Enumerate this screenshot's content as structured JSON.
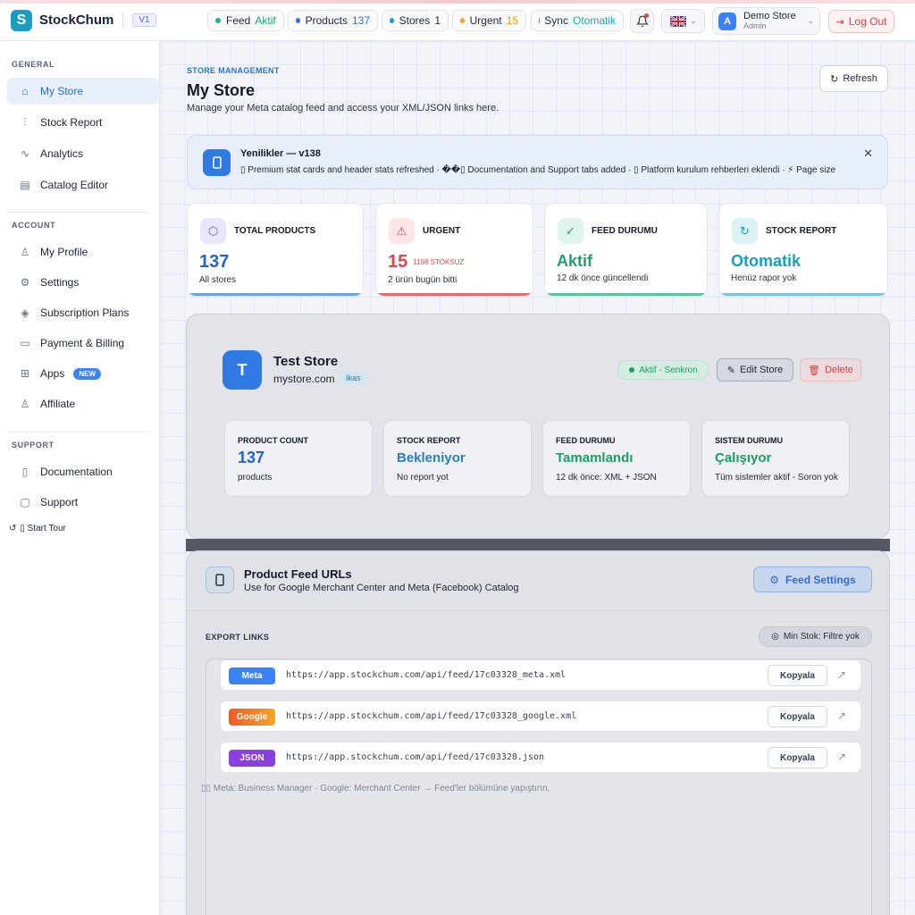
{
  "app": {
    "brand": "StockChum",
    "logo_letter": "S",
    "version": "V1"
  },
  "header": {
    "stats": [
      {
        "label": "Feed",
        "value": "Aktif",
        "dot_color": "#22b573",
        "value_color": "#22a06b"
      },
      {
        "label": "Products",
        "value": "137",
        "dot_color": "#3b6fe0",
        "value_color": "#2f6fd1"
      },
      {
        "label": "Stores",
        "value": "1",
        "dot_color": "#1aa3c9",
        "value_color": "#1f2533"
      },
      {
        "label": "Urgent",
        "value": "15",
        "dot_color": "#f2a51a",
        "value_color": "#e09a0d"
      },
      {
        "label": "Sync",
        "value": "Otomatik",
        "dot_color": "#14b4b0",
        "value_color": "#14a8b4"
      }
    ],
    "notifications_icon": "bell-icon",
    "language_icon": "uk-flag-icon",
    "user": {
      "avatar_letter": "A",
      "name": "Demo Store",
      "role": "Admin"
    },
    "logout_label": "Log Out"
  },
  "sidebar": {
    "general_title": "GENERAL",
    "general_items": [
      {
        "label": "My Store",
        "icon": "home-icon"
      },
      {
        "label": "Stock Report",
        "icon": "bar-chart-icon"
      },
      {
        "label": "Analytics",
        "icon": "activity-icon"
      },
      {
        "label": "Catalog Editor",
        "icon": "grid-icon"
      }
    ],
    "account_title": "ACCOUNT",
    "account_items": [
      {
        "label": "My Profile",
        "icon": "user-icon"
      },
      {
        "label": "Settings",
        "icon": "gear-icon"
      },
      {
        "label": "Subscription Plans",
        "icon": "layers-icon"
      },
      {
        "label": "Payment & Billing",
        "icon": "credit-card-icon"
      },
      {
        "label": "Apps",
        "icon": "apps-icon",
        "badge": "NEW"
      },
      {
        "label": "Affiliate",
        "icon": "user-plus-icon"
      }
    ],
    "support_title": "SUPPORT",
    "support_items": [
      {
        "label": "Documentation",
        "icon": "book-icon"
      },
      {
        "label": "Support",
        "icon": "chat-icon"
      }
    ],
    "start_tour": "▯ Start Tour"
  },
  "page": {
    "eyebrow": "STORE MANAGEMENT",
    "title": "My Store",
    "subtitle": "Manage your Meta catalog feed and access your XML/JSON links here.",
    "refresh_label": "Refresh"
  },
  "news": {
    "title": "Yenilikler — v138",
    "text": "▯ Premium stat cards and header stats refreshed · ��▯ Documentation and Support tabs added · ▯ Platform kurulum rehberleri eklendi · ⚡ Page size"
  },
  "stat_cards": [
    {
      "label": "TOTAL PRODUCTS",
      "value": "137",
      "tag": "",
      "sub": "All stores",
      "value_color": "#2463c9",
      "accent": "#6aa3e8",
      "icon": "cube-icon",
      "icon_bg": "#e9e5fb",
      "icon_color": "#6b56d9"
    },
    {
      "label": "URGENT",
      "value": "15",
      "tag": "1198 STOKSUZ",
      "sub": "2 ürün bugün bitti",
      "value_color": "#e0454e",
      "accent": "#e86a70",
      "icon": "warning-icon",
      "icon_bg": "#fde6e7",
      "icon_color": "#e0454e"
    },
    {
      "label": "FEED DURUMU",
      "value": "Aktif",
      "tag": "",
      "sub": "12 dk önce güncellendi",
      "value_color": "#22a06b",
      "accent": "#5cc49a",
      "icon": "check-circle-icon",
      "icon_bg": "#dff4ea",
      "icon_color": "#22a06b"
    },
    {
      "label": "STOCK REPORT",
      "value": "Otomatik",
      "tag": "",
      "sub": "Henüz rapor yok",
      "value_color": "#14a0b8",
      "accent": "#79c4d8",
      "icon": "refresh-icon",
      "icon_bg": "#ddf2f6",
      "icon_color": "#14a0b8"
    }
  ],
  "store": {
    "avatar_letter": "T",
    "name": "Test Store",
    "url": "mystore.com",
    "platform": "Ikas",
    "status": "Aktif - Senkron",
    "edit_label": "Edit Store",
    "delete_label": "Delete",
    "cards": [
      {
        "label": "PRODUCT COUNT",
        "value": "137",
        "sub": "products",
        "value_color": "#2463c9"
      },
      {
        "label": "STOCK REPORT",
        "value": "Bekleniyor",
        "sub": "No report yot",
        "value_color": "#2a7fc0"
      },
      {
        "label": "FEED DURUMU",
        "value": "Tamamlandı",
        "sub": "12 dk önce: XML + JSON",
        "value_color": "#1f9d68"
      },
      {
        "label": "SISTEM DURUMU",
        "value": "Çalışıyor",
        "sub": "Tüm sistemler aktif - Soron yok",
        "value_color": "#1f9d68"
      }
    ]
  },
  "feed": {
    "title": "Product Feed URLs",
    "subtitle": "Use for Google Merchant Center and Meta (Facebook) Catalog",
    "settings_label": "Feed Settings",
    "export_label": "EXPORT LINKS",
    "min_stock": "Min Stok: Filtre yok",
    "links": [
      {
        "source": "Meta",
        "url": "https://app.stockchum.com/api/feed/17c03328_meta.xml",
        "color": "#3b82f6"
      },
      {
        "source": "Google",
        "url": "https://app.stockchum.com/api/feed/17c03328_google.xml",
        "color": "#f05a28"
      },
      {
        "source": "JSON",
        "url": "https://app.stockchum.com/api/feed/17c03328.json",
        "color": "#8b3fe0"
      }
    ],
    "copy_label": "Kopyala",
    "hint": "▯▯ Meta: Business Manager · Google: Merchant Center → Feed'ler bölümüne yapıştırın."
  }
}
